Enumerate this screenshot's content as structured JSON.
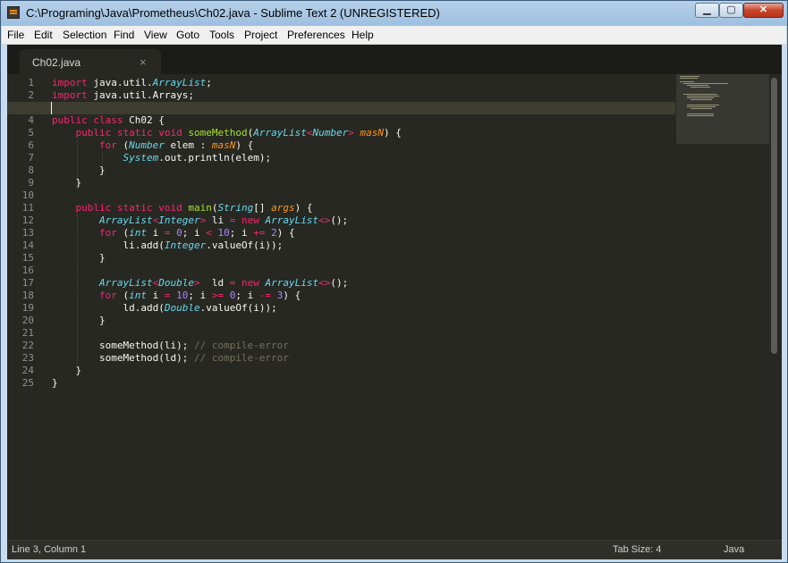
{
  "window": {
    "title": "C:\\Programing\\Java\\Prometheus\\Ch02.java - Sublime Text 2 (UNREGISTERED)",
    "controls": {
      "minimize": "▁",
      "maximize": "▢",
      "close": "✕"
    }
  },
  "menu": [
    "File",
    "Edit",
    "Selection",
    "Find",
    "View",
    "Goto",
    "Tools",
    "Project",
    "Preferences",
    "Help"
  ],
  "tabs": [
    {
      "label": "Ch02.java",
      "close": "×"
    }
  ],
  "editor": {
    "current_line": 3,
    "line_numbers": [
      "1",
      "2",
      "3",
      "4",
      "5",
      "6",
      "7",
      "8",
      "9",
      "10",
      "11",
      "12",
      "13",
      "14",
      "15",
      "16",
      "17",
      "18",
      "19",
      "20",
      "21",
      "22",
      "23",
      "24",
      "25"
    ],
    "lines": [
      "import java.util.ArrayList;",
      "import java.util.Arrays;",
      "",
      "public class Ch02 {",
      "    public static void someMethod(ArrayList<Number> masN) {",
      "        for (Number elem : masN) {",
      "            System.out.println(elem);",
      "        }",
      "    }",
      "",
      "    public static void main(String[] args) {",
      "        ArrayList<Integer> li = new ArrayList<>();",
      "        for (int i = 0; i < 10; i += 2) {",
      "            li.add(Integer.valueOf(i));",
      "        }",
      "",
      "        ArrayList<Double>  ld = new ArrayList<>();",
      "        for (int i = 10; i >= 0; i -= 3) {",
      "            ld.add(Double.valueOf(i));",
      "        }",
      "",
      "        someMethod(li); // compile-error",
      "        someMethod(ld); // compile-error",
      "    }",
      "}"
    ]
  },
  "status": {
    "position": "Line 3, Column 1",
    "tab_size": "Tab Size: 4",
    "syntax": "Java"
  },
  "colors": {
    "background": "#272822",
    "keyword": "#f92672",
    "type": "#66d9ef",
    "function": "#a6e22e",
    "number": "#ae81ff",
    "comment": "#75715e",
    "argument": "#fd971f"
  }
}
